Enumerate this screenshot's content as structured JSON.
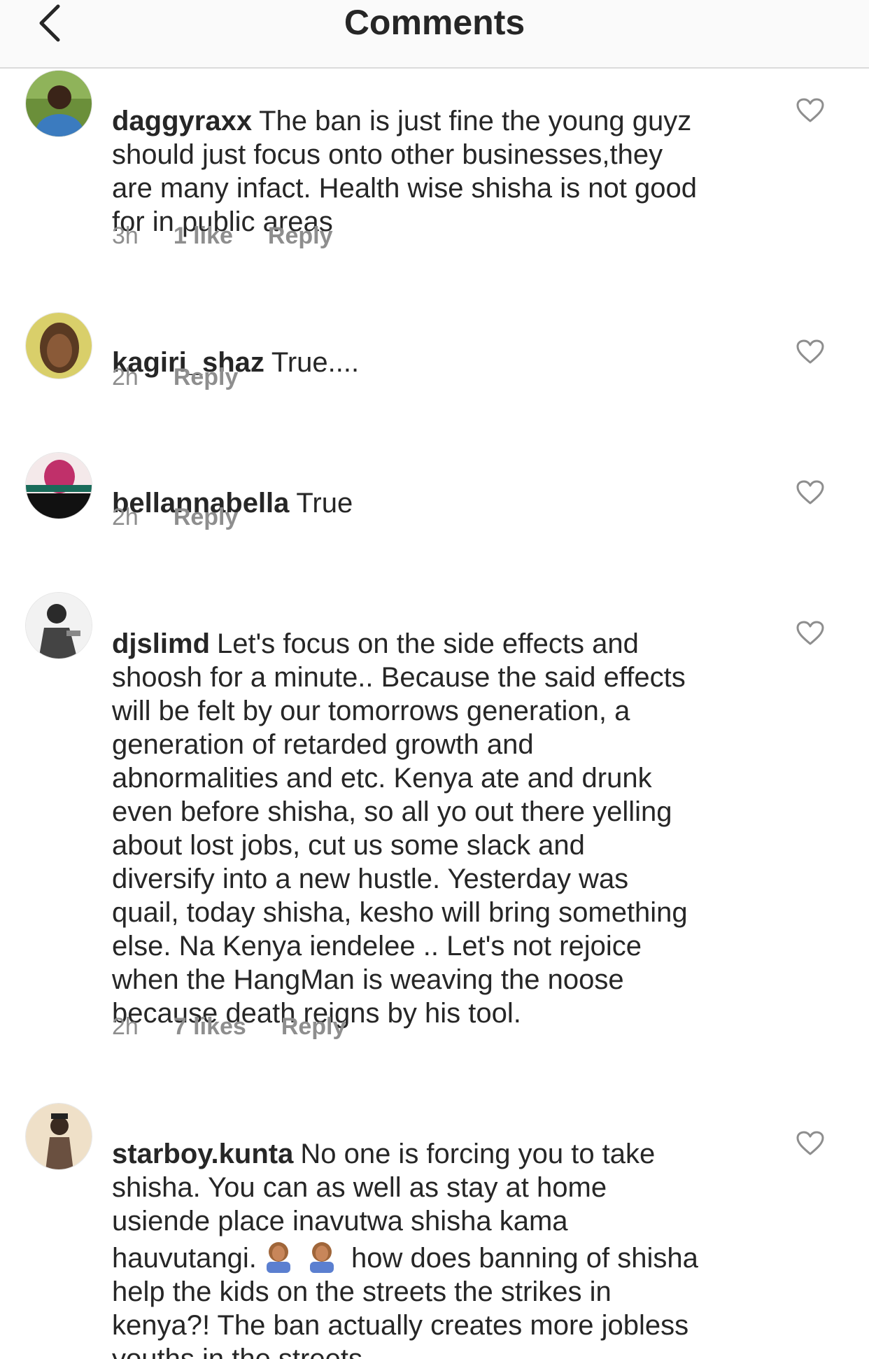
{
  "header": {
    "title": "Comments",
    "back_icon": "chevron-left-icon"
  },
  "comments": [
    {
      "username": "daggyraxx",
      "text": "The ban is just fine the young guyz\nshould just focus onto other businesses,they\nare many infact. Health wise shisha is not good\nfor in public areas",
      "time": "3h",
      "likes": "1 like",
      "reply": "Reply",
      "avatar_color": "#3b7bbf"
    },
    {
      "username": "kagiri_shaz",
      "text": "True....",
      "time": "2h",
      "likes": "",
      "reply": "Reply",
      "avatar_color": "#c8a04a"
    },
    {
      "username": "bellannabella",
      "text": "True",
      "time": "2h",
      "likes": "",
      "reply": "Reply",
      "avatar_color": "#c0306a"
    },
    {
      "username": "djslimd",
      "text": "Let's focus on the side effects and\nshoosh for a minute.. Because the said  effects\nwill be felt by our tomorrows generation, a\ngeneration of retarded growth and\nabnormalities and etc. Kenya ate and drunk\neven before shisha, so all yo out there yelling\nabout lost jobs, cut us some slack and\ndiversify into a new hustle. Yesterday was\nquail, today shisha, kesho will bring something\nelse. Na Kenya iendelee .. Let's not rejoice\nwhen the HangMan is weaving the noose\nbecause death reigns by his tool.",
      "time": "2h",
      "likes": "7 likes",
      "reply": "Reply",
      "avatar_color": "#555555"
    },
    {
      "username": "starboy.kunta",
      "text_before_emoji": "No one is forcing you to take\nshisha. You can as well as stay at home\nusiende place inavutwa shisha kama\nhauvutangi.",
      "text_after_emoji": "how does banning of shisha\nhelp the kids on the streets the strikes in\nkenya?! The ban actually creates more jobless\nyouths in the streets.",
      "emoji": "face-palm-emoji",
      "avatar_color": "#b08a60"
    }
  ],
  "colors": {
    "text": "#262626",
    "muted": "#8e8e8e",
    "divider": "#dbdbdb",
    "header_bg": "#fafafa"
  }
}
